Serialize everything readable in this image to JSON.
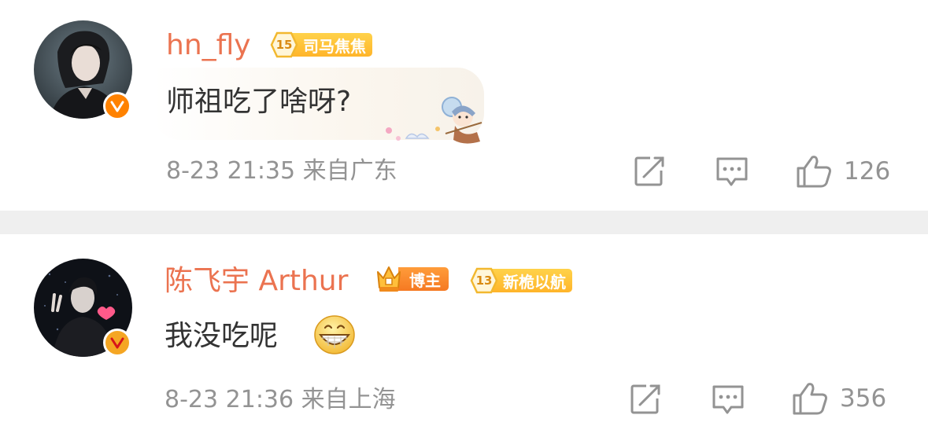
{
  "comments": [
    {
      "username": "hn_fly",
      "level_badge": {
        "level": "15",
        "text": "司马焦焦"
      },
      "text": "师祖吃了啥呀?",
      "date": "8-23",
      "time": "21:35",
      "location": "来自广东",
      "likes": "126",
      "verified_color": "#ff8200"
    },
    {
      "username": "陈飞宇 Arthur",
      "blogger_badge": "博主",
      "level_badge": {
        "level": "13",
        "text": "新桅以航"
      },
      "text": "我没吃呢",
      "date": "8-23",
      "time": "21:36",
      "location": "来自上海",
      "likes": "356",
      "verified_color": "#f5a623"
    }
  ],
  "colors": {
    "username": "#eb7350",
    "meta": "#939393",
    "text": "#333333",
    "divider": "#efefef"
  },
  "icons": [
    "share-icon",
    "comment-icon",
    "like-icon",
    "verified-icon",
    "grin-emoji",
    "decorative-sticker"
  ]
}
